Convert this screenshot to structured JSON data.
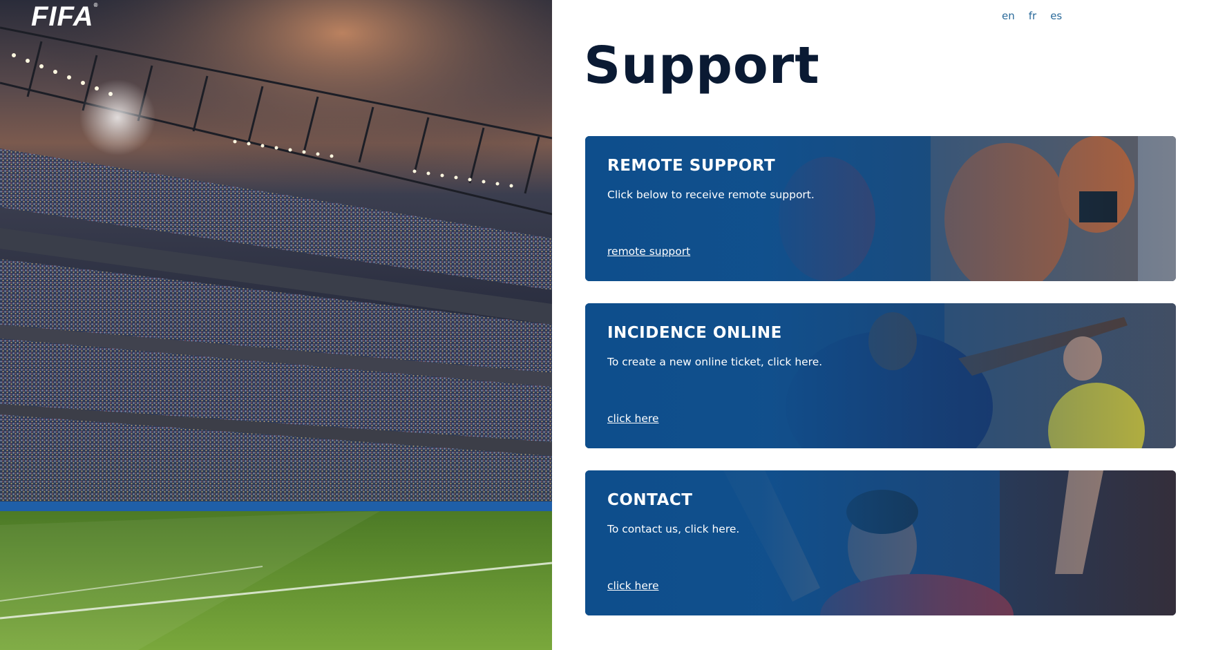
{
  "brand": {
    "logo_text": "FIFA",
    "logo_mark": "®"
  },
  "language_nav": [
    {
      "label": "en"
    },
    {
      "label": "fr"
    },
    {
      "label": "es"
    }
  ],
  "page": {
    "title": "Support"
  },
  "cards": [
    {
      "title": "REMOTE SUPPORT",
      "description": "Click below to receive remote support.",
      "link_label": "remote support"
    },
    {
      "title": "INCIDENCE ONLINE",
      "description": "To create a new online ticket, click here.",
      "link_label": "click here"
    },
    {
      "title": "CONTACT",
      "description": "To contact us, click here.",
      "link_label": "click here"
    }
  ],
  "colors": {
    "card_blue": "#0e4e8c",
    "title_navy": "#0a1a33",
    "link_blue": "#2a6a9a",
    "pitch_green": "#5a8c2c"
  }
}
